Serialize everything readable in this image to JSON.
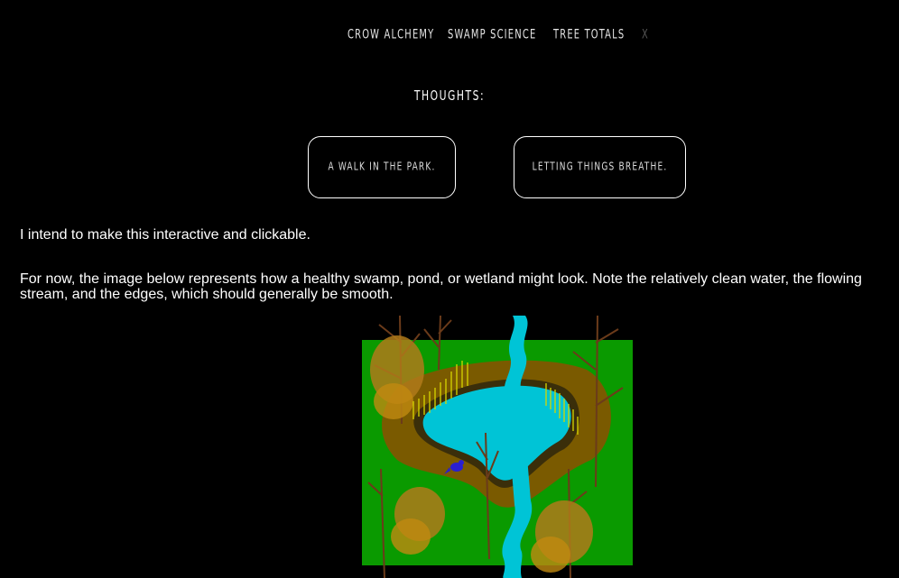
{
  "nav": {
    "items": [
      "CROW ALCHEMY",
      "SWAMP SCIENCE",
      "TREE TOTALS"
    ],
    "close": "X"
  },
  "heading": "THOUGHTS:",
  "cards": [
    {
      "label": "A WALK IN THE PARK."
    },
    {
      "label": "LETTING THINGS BREATHE."
    }
  ],
  "body": {
    "intro": "I intend to make this interactive and clickable.",
    "description": "For now, the image below represents how a healthy swamp, pond, or wetland might look. Note the relatively clean water, the flowing stream, and the edges, which should generally be smooth."
  },
  "colors": {
    "background": "#000000",
    "grass": "#0a9a00",
    "mud": "#7a5a00",
    "water": "#00c4d6",
    "bird": "#2a1fd0"
  }
}
